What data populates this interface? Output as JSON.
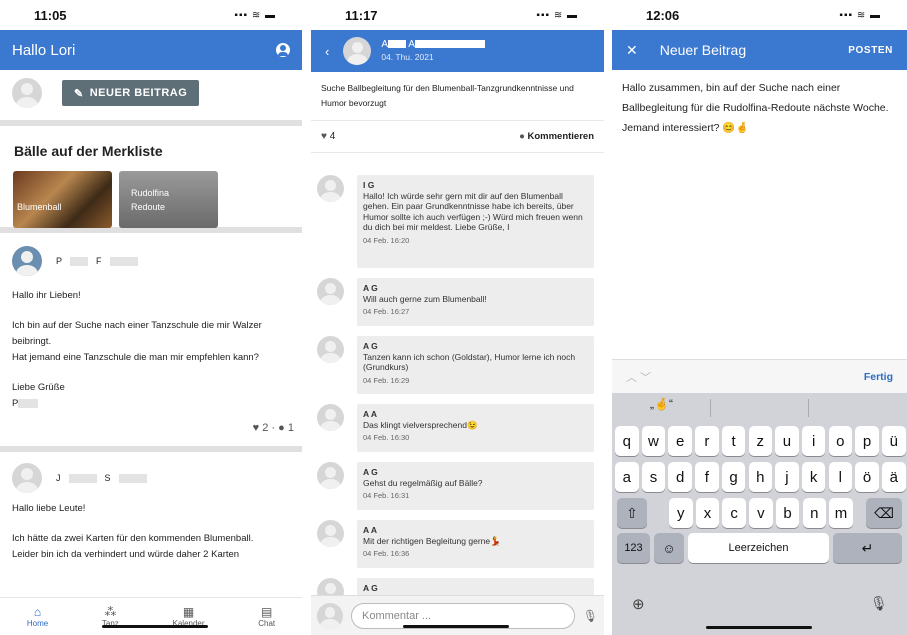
{
  "screen1": {
    "time": "11:05",
    "status_icons": "▪▪▪ ≋ ▬",
    "title": "Hallo Lori",
    "new_post": "NEUER BEITRAG",
    "section": "Bälle auf der Merkliste",
    "balls": [
      "Blumenball",
      "Rudolfina\nRedoute"
    ],
    "post1": {
      "author_initial_first": "P",
      "author_initial_last": "F",
      "lines": [
        "Hallo ihr Lieben!",
        "",
        "Ich bin auf der Suche nach einer Tanzschule die mir Walzer beibringt.",
        "Hat jemand eine Tanzschule die man mir empfehlen kann?",
        "",
        "Liebe Grüße",
        "P"
      ],
      "likes": "2 ·",
      "comments": "1"
    },
    "post2": {
      "author_initial_first": "J",
      "author_initial_last": "S",
      "lines": [
        "Hallo liebe Leute!",
        "",
        "Ich hätte da zwei Karten für den kommenden Blumenball.",
        "Leider bin ich da verhindert und würde daher 2 Karten"
      ]
    },
    "nav": [
      {
        "icon": "home-icon",
        "label": "Home"
      },
      {
        "icon": "group-icon",
        "label": "Tanz"
      },
      {
        "icon": "calendar-icon",
        "label": "Kalender"
      },
      {
        "icon": "chat-icon",
        "label": "Chat"
      }
    ]
  },
  "screen2": {
    "time": "11:17",
    "header_name_a": "A",
    "header_name_b": "A",
    "header_date": "04. Thu. 2021",
    "post_text": "Suche Ballbegleitung für den Blumenball-Tanzgrundkenntnisse und Humor bevorzugt",
    "likes": "4",
    "comment_btn": "Kommentieren",
    "comment_placeholder": "Kommentar ...",
    "comments": [
      {
        "name": "I  G",
        "text": "Hallo! Ich würde sehr gern mit dir auf den Blumenball gehen. Ein paar Grundkenntnisse habe ich bereits, über Humor sollte ich auch verfügen ;-) Würd mich freuen wenn du dich bei mir meldest. Liebe Grüße, I",
        "time": "04 Feb. 16:20"
      },
      {
        "name": "A G",
        "text": "Will auch gerne zum Blumenball!",
        "time": "04 Feb. 16:27"
      },
      {
        "name": "A G",
        "text": "Tanzen kann ich schon (Goldstar), Humor lerne ich noch (Grundkurs)",
        "time": "04 Feb. 16:29"
      },
      {
        "name": "A  A",
        "text": "Das klingt vielversprechend😉",
        "time": "04 Feb. 16:30"
      },
      {
        "name": "A G",
        "text": "Gehst du regelmäßig auf Bälle?",
        "time": "04 Feb. 16:31"
      },
      {
        "name": "A  A",
        "text": "Mit der richtigen Begleitung gerne💃",
        "time": "04 Feb. 16:36"
      },
      {
        "name": "A G",
        "text": "",
        "time": ""
      }
    ]
  },
  "screen3": {
    "time": "12:06",
    "title": "Neuer Beitrag",
    "post_btn": "POSTEN",
    "body": "Hallo zusammen, bin auf der Suche nach einer Ballbegleitung für die Rudolfina-Redoute nächste Woche. Jemand interessiert? 😊🤞",
    "done": "Fertig",
    "suggestion": "„🤞“",
    "row1": [
      "q",
      "w",
      "e",
      "r",
      "t",
      "z",
      "u",
      "i",
      "o",
      "p",
      "ü"
    ],
    "row2": [
      "a",
      "s",
      "d",
      "f",
      "g",
      "h",
      "j",
      "k",
      "l",
      "ö",
      "ä"
    ],
    "row3": [
      "y",
      "x",
      "c",
      "v",
      "b",
      "n",
      "m"
    ],
    "num": "123",
    "space": "Leerzeichen"
  }
}
